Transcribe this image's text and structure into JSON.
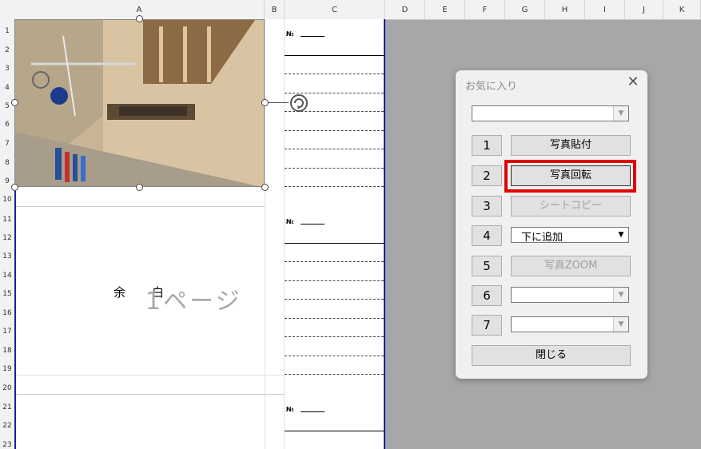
{
  "spreadsheet": {
    "columns": [
      "A",
      "B",
      "C",
      "D",
      "E",
      "F",
      "G",
      "H",
      "I",
      "J",
      "K"
    ],
    "rows": [
      "1",
      "2",
      "3",
      "4",
      "5",
      "6",
      "7",
      "8",
      "9",
      "10",
      "11",
      "12",
      "13",
      "14",
      "15",
      "16",
      "17",
      "18",
      "19",
      "20",
      "21",
      "22",
      "23"
    ],
    "no_label": "№",
    "margin_left": "余",
    "margin_right": "白",
    "page_watermark": "1ページ"
  },
  "dialog": {
    "title": "お気に入り",
    "close": "✕",
    "top_combo_value": "",
    "buttons": [
      {
        "num": "1",
        "label": "写真貼付",
        "enabled": true
      },
      {
        "num": "2",
        "label": "写真回転",
        "enabled": true,
        "highlighted": true
      },
      {
        "num": "3",
        "label": "シートコピー",
        "enabled": false
      },
      {
        "num": "4",
        "label": "下に追加",
        "type": "combo"
      },
      {
        "num": "5",
        "label": "写真ZOOM",
        "enabled": false
      },
      {
        "num": "6",
        "label": "",
        "type": "combo"
      },
      {
        "num": "7",
        "label": "",
        "type": "combo"
      }
    ],
    "close_button": "閉じる"
  },
  "colors": {
    "page_border": "#1a1fa8",
    "highlight": "#e20000"
  }
}
